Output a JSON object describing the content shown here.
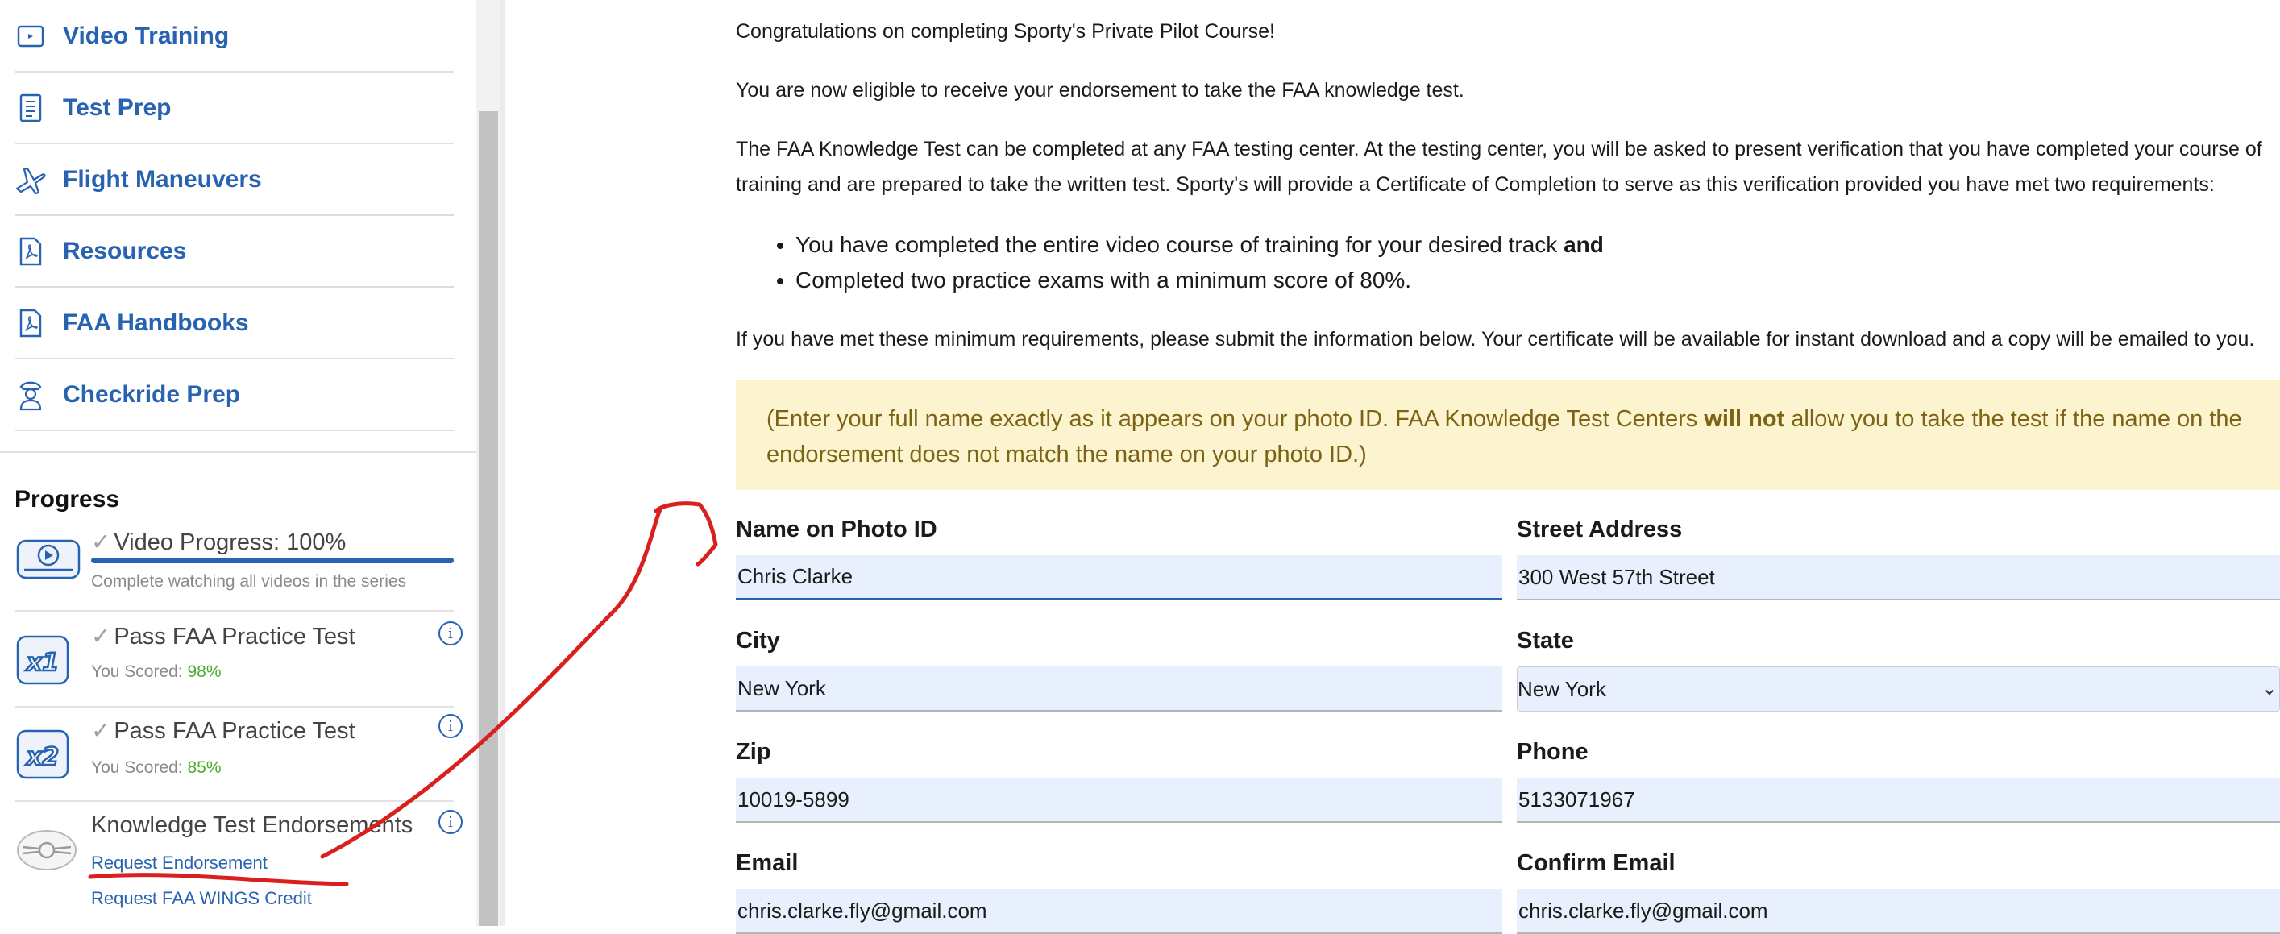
{
  "sidebar": {
    "nav": [
      {
        "label": "Video Training",
        "icon": "video-icon"
      },
      {
        "label": "Test Prep",
        "icon": "document-list-icon"
      },
      {
        "label": "Flight Maneuvers",
        "icon": "airplane-icon"
      },
      {
        "label": "Resources",
        "icon": "pdf-icon"
      },
      {
        "label": "FAA Handbooks",
        "icon": "pdf-icon"
      },
      {
        "label": "Checkride Prep",
        "icon": "pilot-icon"
      }
    ],
    "progress_title": "Progress",
    "progress": {
      "video": {
        "title": "Video Progress: 100%",
        "subtitle": "Complete watching all videos in the series",
        "percent": 100
      },
      "test1": {
        "title": "Pass FAA Practice Test",
        "scored_label": "You Scored: ",
        "score": "98%",
        "badge": "x1"
      },
      "test2": {
        "title": "Pass FAA Practice Test",
        "scored_label": "You Scored: ",
        "score": "85%",
        "badge": "x2"
      },
      "endorse": {
        "title": "Knowledge Test Endorsements",
        "link1": "Request Endorsement",
        "link2": "Request FAA WINGS Credit"
      }
    }
  },
  "main": {
    "p1": "Congratulations on completing Sporty's Private Pilot Course!",
    "p2": "You are now eligible to receive your endorsement to take the FAA knowledge test.",
    "p3a": "The FAA Knowledge Test can be completed at any FAA testing center. At the testing center, you will be asked to present verification that you have completed your course of",
    "p3b": "training and are prepared to take the written test. Sporty's will provide a Certificate of Completion to serve as this verification provided you have met two requirements:",
    "req1": "You have completed the entire video course of training for your desired track ",
    "req1_bold": "and",
    "req2": "Completed two practice exams with a minimum score of 80%.",
    "p4": "If you have met these minimum requirements, please submit the information below. Your certificate will be available for instant download and a copy will be emailed to you.",
    "note_a": "(Enter your full name exactly as it appears on your photo ID. FAA Knowledge Test Centers ",
    "note_bold": "will not",
    "note_b": " allow you to take the test if the name on the",
    "note_c": "endorsement does not match the name on your photo ID.)"
  },
  "form": {
    "name_label": "Name on Photo ID",
    "name_value": "Chris Clarke",
    "street_label": "Street Address",
    "street_value": "300 West 57th Street",
    "city_label": "City",
    "city_value": "New York",
    "state_label": "State",
    "state_value": "New York",
    "zip_label": "Zip",
    "zip_value": "10019-5899",
    "phone_label": "Phone",
    "phone_value": "5133071967",
    "email_label": "Email",
    "email_value": "chris.clarke.fly@gmail.com",
    "confirm_label": "Confirm Email",
    "confirm_value": "chris.clarke.fly@gmail.com"
  },
  "colors": {
    "link": "#2763b0",
    "note_bg": "#fcf3cf",
    "note_text": "#7c6414",
    "score": "#4caa2c",
    "annotation": "#d9201e",
    "input_bg": "#e8f0fe"
  }
}
